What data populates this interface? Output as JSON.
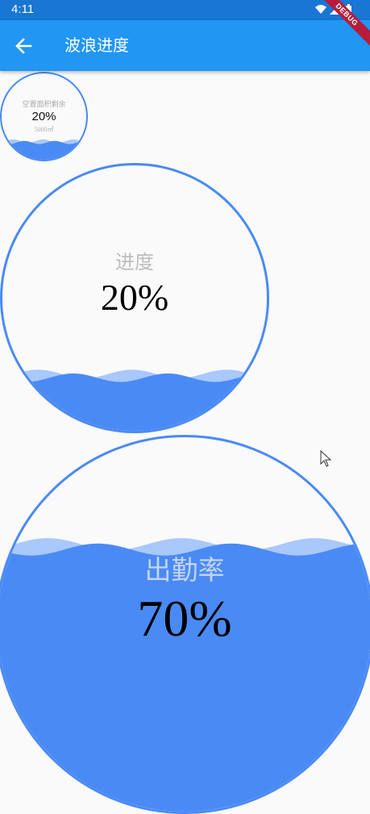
{
  "status_bar": {
    "time": "4:11",
    "icons": [
      "wifi-icon",
      "signal-icon",
      "battery-icon"
    ]
  },
  "debug_banner": "DEBUG",
  "app_bar": {
    "title": "波浪进度",
    "back_icon": "arrow-back-icon"
  },
  "colors": {
    "status_bar": "#1976d2",
    "app_bar": "#2196f3",
    "wave": "#4a8af4",
    "wave_light": "#a9c8fb",
    "background": "#fafafa"
  },
  "waves": [
    {
      "id": "small",
      "label": "空置面积剩余",
      "value_text": "20%",
      "progress": 0.2,
      "subtext": "5000㎡"
    },
    {
      "id": "medium",
      "label": "进度",
      "value_text": "20%",
      "progress": 0.2
    },
    {
      "id": "large",
      "label": "出勤率",
      "value_text": "70%",
      "progress": 0.7
    }
  ]
}
